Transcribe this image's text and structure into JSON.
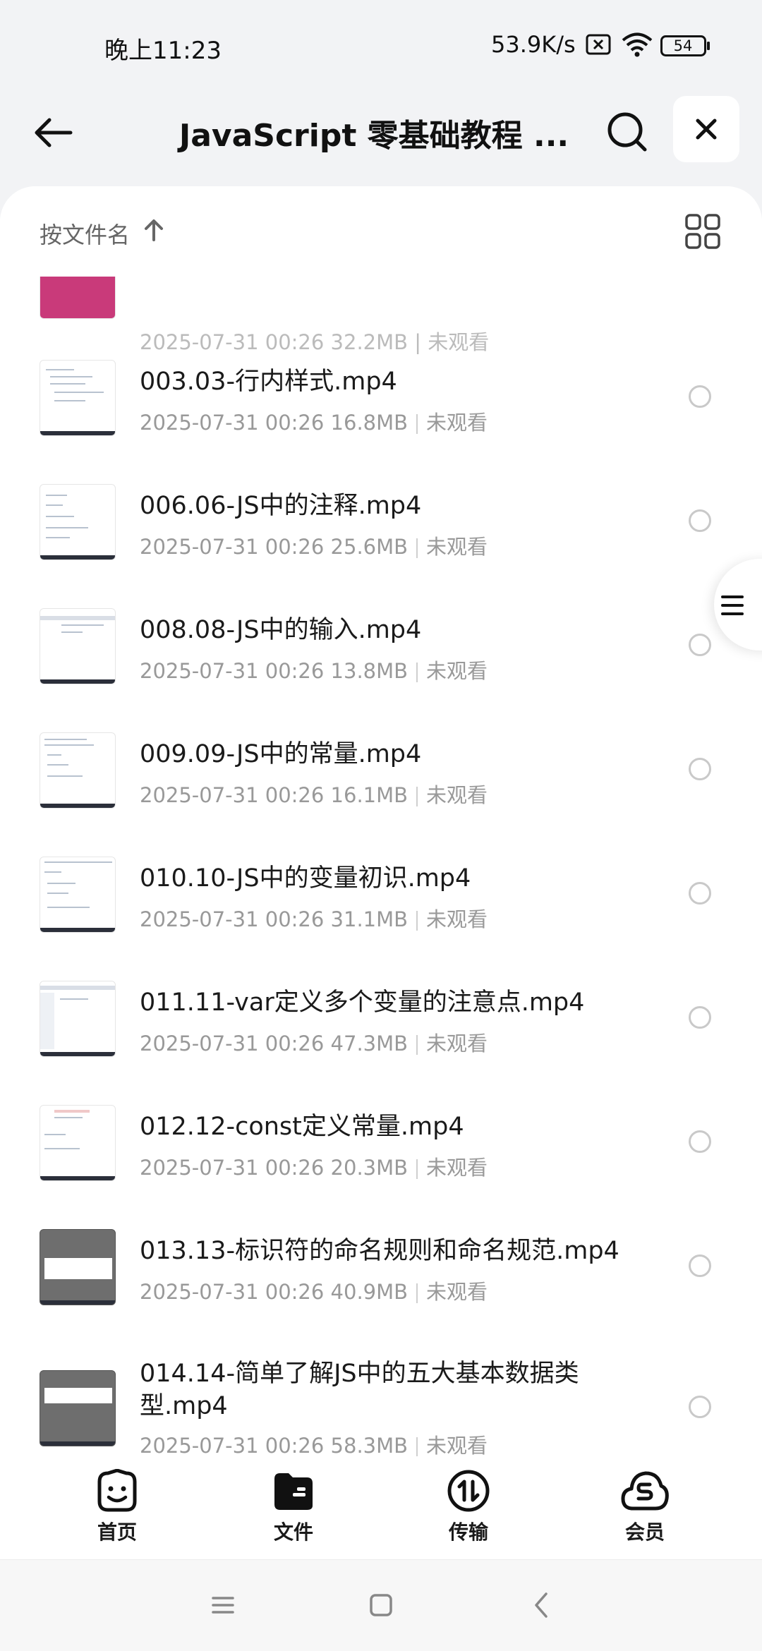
{
  "status_bar": {
    "time": "晚上11:23",
    "speed": "53.9K/s",
    "battery": "54",
    "icons": [
      "sim-x-icon",
      "wifi-icon",
      "battery-icon"
    ]
  },
  "header": {
    "title": "JavaScript 零基础教程 ...",
    "icons": [
      "back-arrow-icon",
      "search-icon",
      "close-icon"
    ]
  },
  "sort": {
    "label": "按文件名",
    "direction": "ascending",
    "view_icon": "grid-view-icon"
  },
  "partial_item": {
    "meta": "2025-07-31 00:26  32.2MB | 未观看"
  },
  "files": [
    {
      "name": "003.03-行内样式.mp4",
      "date": "2025-07-31 00:26",
      "size": "16.8MB",
      "status": "未观看"
    },
    {
      "name": "006.06-JS中的注释.mp4",
      "date": "2025-07-31 00:26",
      "size": "25.6MB",
      "status": "未观看"
    },
    {
      "name": "008.08-JS中的输入.mp4",
      "date": "2025-07-31 00:26",
      "size": "13.8MB",
      "status": "未观看"
    },
    {
      "name": "009.09-JS中的常量.mp4",
      "date": "2025-07-31 00:26",
      "size": "16.1MB",
      "status": "未观看"
    },
    {
      "name": "010.10-JS中的变量初识.mp4",
      "date": "2025-07-31 00:26",
      "size": "31.1MB",
      "status": "未观看"
    },
    {
      "name": "011.11-var定义多个变量的注意点.mp4",
      "date": "2025-07-31 00:26",
      "size": "47.3MB",
      "status": "未观看"
    },
    {
      "name": "012.12-const定义常量.mp4",
      "date": "2025-07-31 00:26",
      "size": "20.3MB",
      "status": "未观看"
    },
    {
      "name": "013.13-标识符的命名规则和命名规范.mp4",
      "date": "2025-07-31 00:26",
      "size": "40.9MB",
      "status": "未观看"
    },
    {
      "name": "014.14-简单了解JS中的五大基本数据类型.mp4",
      "date": "2025-07-31 00:26",
      "size": "58.3MB",
      "status": "未观看"
    }
  ],
  "bottom_nav": [
    {
      "label": "首页",
      "icon": "smile-face-icon"
    },
    {
      "label": "文件",
      "icon": "folder-icon",
      "active": true
    },
    {
      "label": "传输",
      "icon": "transfer-icon"
    },
    {
      "label": "会员",
      "icon": "cloud-member-icon"
    }
  ],
  "system_nav": [
    "menu-icon",
    "home-square-icon",
    "back-chevron-icon"
  ]
}
